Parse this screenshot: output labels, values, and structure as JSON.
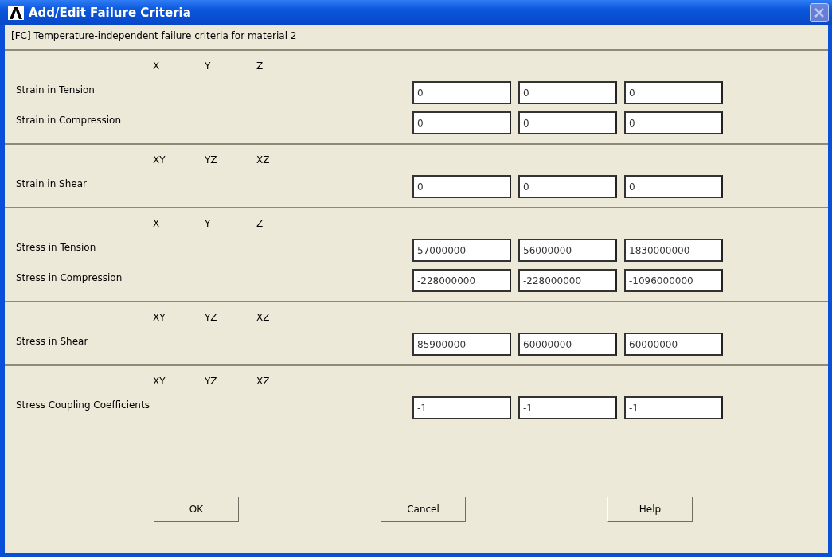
{
  "window": {
    "title": "Add/Edit Failure Criteria",
    "close_disabled": true
  },
  "subtitle": "[FC] Temperature-independent failure criteria for material 2",
  "sections": [
    {
      "axes": [
        "X",
        "Y",
        "Z"
      ],
      "rows": [
        {
          "label": "Strain in Tension",
          "values": [
            "0",
            "0",
            "0"
          ]
        },
        {
          "label": "Strain in Compression",
          "values": [
            "0",
            "0",
            "0"
          ]
        }
      ]
    },
    {
      "axes": [
        "XY",
        "YZ",
        "XZ"
      ],
      "rows": [
        {
          "label": "Strain in Shear",
          "values": [
            "0",
            "0",
            "0"
          ]
        }
      ]
    },
    {
      "axes": [
        "X",
        "Y",
        "Z"
      ],
      "rows": [
        {
          "label": "Stress in Tension",
          "values": [
            "57000000",
            "56000000",
            "1830000000"
          ]
        },
        {
          "label": "Stress in Compression",
          "values": [
            "-228000000",
            "-228000000",
            "-1096000000"
          ]
        }
      ]
    },
    {
      "axes": [
        "XY",
        "YZ",
        "XZ"
      ],
      "rows": [
        {
          "label": "Stress in Shear",
          "values": [
            "85900000",
            "60000000",
            "60000000"
          ]
        }
      ]
    },
    {
      "axes": [
        "XY",
        "YZ",
        "XZ"
      ],
      "rows": [
        {
          "label": "Stress Coupling Coefficients",
          "values": [
            "-1",
            "-1",
            "-1"
          ]
        }
      ]
    }
  ],
  "buttons": [
    "OK",
    "Cancel",
    "Help"
  ]
}
